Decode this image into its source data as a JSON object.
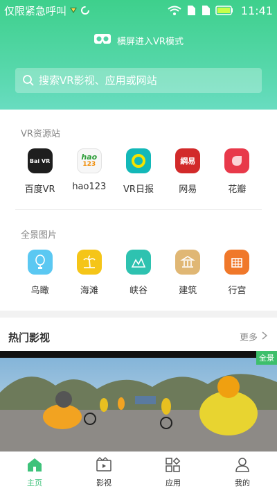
{
  "status_bar": {
    "carrier": "仅限紧急呼叫",
    "time": "11:41"
  },
  "header": {
    "vr_mode_label": "横屏进入VR模式"
  },
  "search": {
    "placeholder": "搜索VR影视、应用或网站"
  },
  "vr_sites": {
    "title": "VR资源站",
    "items": [
      {
        "label": "百度VR",
        "icon": "baidu-vr-icon",
        "color": "#1e1e1e"
      },
      {
        "label": "hao123",
        "icon": "hao123-icon",
        "color": "#f5f5f5"
      },
      {
        "label": "VR日报",
        "icon": "vr-daily-icon",
        "color": "#13b8b8"
      },
      {
        "label": "网易",
        "icon": "netease-icon",
        "color": "#d22a2a"
      },
      {
        "label": "花瓣",
        "icon": "huaban-icon",
        "color": "#e8394a"
      }
    ],
    "icon_texts": {
      "baidu": "Bai VR",
      "hao": "hao",
      "hao_num": "123",
      "netease": "網易"
    }
  },
  "panorama": {
    "title": "全景图片",
    "items": [
      {
        "label": "鸟瞰",
        "icon": "balloon-icon",
        "color": "#5bc8f2"
      },
      {
        "label": "海滩",
        "icon": "palm-tree-icon",
        "color": "#f5c518"
      },
      {
        "label": "峡谷",
        "icon": "mountain-icon",
        "color": "#2ec2b0"
      },
      {
        "label": "建筑",
        "icon": "building-icon",
        "color": "#e0b774"
      },
      {
        "label": "行宫",
        "icon": "palace-icon",
        "color": "#f0782a"
      }
    ]
  },
  "hot_videos": {
    "title": "热门影视",
    "more": "更多",
    "badge": "全景"
  },
  "tabbar": {
    "items": [
      {
        "label": "主页",
        "icon": "home-icon",
        "active": true
      },
      {
        "label": "影视",
        "icon": "film-icon",
        "active": false
      },
      {
        "label": "应用",
        "icon": "apps-icon",
        "active": false
      },
      {
        "label": "我的",
        "icon": "user-icon",
        "active": false
      }
    ]
  },
  "colors": {
    "accent": "#3ec27a",
    "header_top": "#3ed08c",
    "header_bottom": "#68dcc0"
  }
}
